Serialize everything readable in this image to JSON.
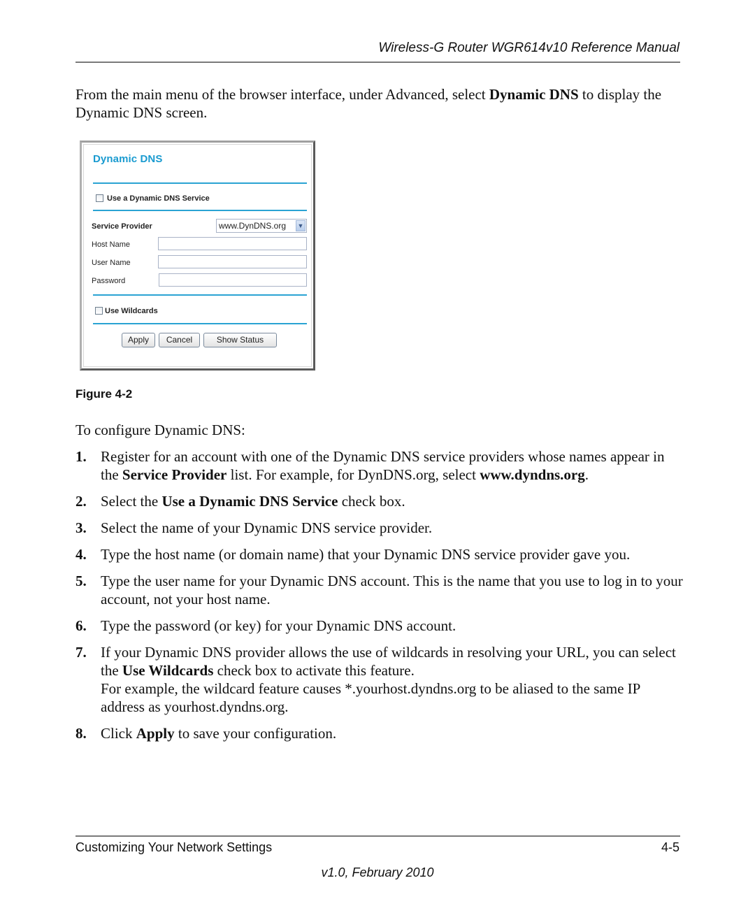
{
  "header": {
    "title": "Wireless-G Router WGR614v10 Reference Manual"
  },
  "intro": {
    "part1": "From the main menu of the browser interface, under Advanced, select ",
    "bold": "Dynamic DNS",
    "part2": " to display the Dynamic DNS screen."
  },
  "figure": {
    "title": "Dynamic DNS",
    "use_service_label": "Use a Dynamic DNS Service",
    "use_service_checked": false,
    "service_provider_label": "Service Provider",
    "service_provider_value": "www.DynDNS.org",
    "host_name_label": "Host Name",
    "host_name_value": "",
    "user_name_label": "User Name",
    "user_name_value": "",
    "password_label": "Password",
    "password_value": "",
    "use_wildcards_label": "Use Wildcards",
    "use_wildcards_checked": false,
    "buttons": {
      "apply": "Apply",
      "cancel": "Cancel",
      "show_status": "Show Status"
    },
    "caption": "Figure 4-2"
  },
  "lead": "To configure Dynamic DNS:",
  "steps": [
    {
      "num": "1.",
      "a": "Register for an account with one of the Dynamic DNS service providers whose names appear in the ",
      "b1": "Service Provider",
      "c": " list. For example, for DynDNS.org, select ",
      "b2": "www.dyndns.org",
      "d": "."
    },
    {
      "num": "2.",
      "a": "Select the ",
      "b1": "Use a Dynamic DNS Service",
      "c": " check box."
    },
    {
      "num": "3.",
      "a": "Select the name of your Dynamic DNS service provider."
    },
    {
      "num": "4.",
      "a": "Type the host name (or domain name) that your Dynamic DNS service provider gave you."
    },
    {
      "num": "5.",
      "a": "Type the user name for your Dynamic DNS account. This is the name that you use to log in to your account, not your host name."
    },
    {
      "num": "6.",
      "a": "Type the password (or key) for your Dynamic DNS account."
    },
    {
      "num": "7.",
      "a": "If your Dynamic DNS provider allows the use of wildcards in resolving your URL, you can select the ",
      "b1": "Use Wildcards",
      "c": " check box to activate this feature.",
      "extra": "For example, the wildcard feature causes *.yourhost.dyndns.org to be aliased to the same IP address as yourhost.dyndns.org."
    },
    {
      "num": "8.",
      "a": "Click ",
      "b1": "Apply",
      "c": " to save your configuration."
    }
  ],
  "footer": {
    "section": "Customizing Your Network Settings",
    "page": "4-5",
    "version": "v1.0, February 2010"
  }
}
